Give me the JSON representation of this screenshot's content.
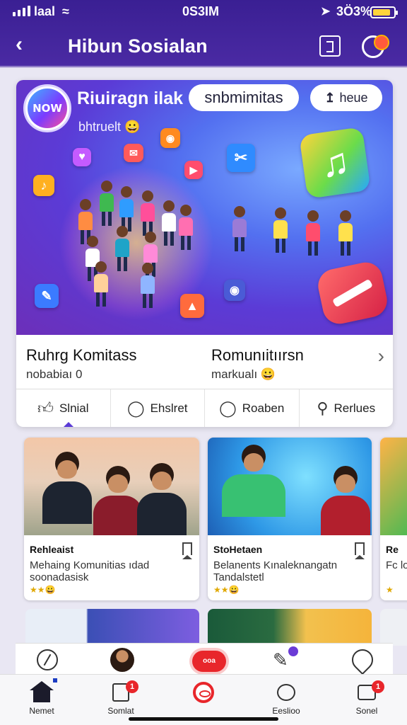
{
  "status_bar": {
    "carrier": "laal",
    "time": "0S3IM",
    "battery_pct": "3Ö3%",
    "battery_level": 0.85,
    "icons": [
      "signal-icon",
      "wifi-icon",
      "location-icon",
      "battery-icon"
    ]
  },
  "header": {
    "title": "Hibun Sosialan",
    "back_icon": "chevron-left-icon",
    "actions": [
      "frame-icon",
      "notification-icon"
    ]
  },
  "hero": {
    "logo_text": "NOW",
    "title": "Riuiragn ilak",
    "subtitle": "bhtruelt 😀",
    "search_pill": "snbmimitas",
    "share_pill": "heue",
    "share_icon": "share-icon"
  },
  "info_row": {
    "col1_title": "Ruhrg Komitass",
    "col1_sub": "nobabiaı 0",
    "col2_title": "Romunıitıırsn",
    "col2_sub": "markualı 😀"
  },
  "tabs": [
    {
      "label": "Slnial",
      "icon": "thumbs-up-icon"
    },
    {
      "label": "Ehslret",
      "icon": "speech-bubble-icon"
    },
    {
      "label": "Roaben",
      "icon": "chat-icon"
    },
    {
      "label": "Rerlues",
      "icon": "search-icon"
    }
  ],
  "feed": {
    "cards": [
      {
        "title": "Rehleaist",
        "desc": "Mehaing Komunitias ıdad soonadasisk",
        "rating": "★★😀"
      },
      {
        "title": "StoHetaen",
        "desc": "Belanents Kınaleknangatn Tandalstetl",
        "rating": "★★😀"
      },
      {
        "title": "Re",
        "desc": "Fc lo",
        "rating": "★"
      }
    ]
  },
  "quick_actions": {
    "items": [
      "compass-icon",
      "avatar-icon",
      "record-icon",
      "edit-icon",
      "location-pin-icon"
    ],
    "record_label": "ooa"
  },
  "bottom_nav": [
    {
      "label": "Nemet",
      "icon": "home-icon"
    },
    {
      "label": "Somlat",
      "icon": "document-icon",
      "badge": "1"
    },
    {
      "label": "",
      "icon": "record-icon"
    },
    {
      "label": "Eeslioo",
      "icon": "chat-bubble-icon"
    },
    {
      "label": "Sonel",
      "icon": "inbox-icon",
      "badge": "1"
    }
  ],
  "colors": {
    "brand_purple": "#4a2aa3",
    "accent_red": "#e8262b",
    "rating_gold": "#e0a800"
  }
}
